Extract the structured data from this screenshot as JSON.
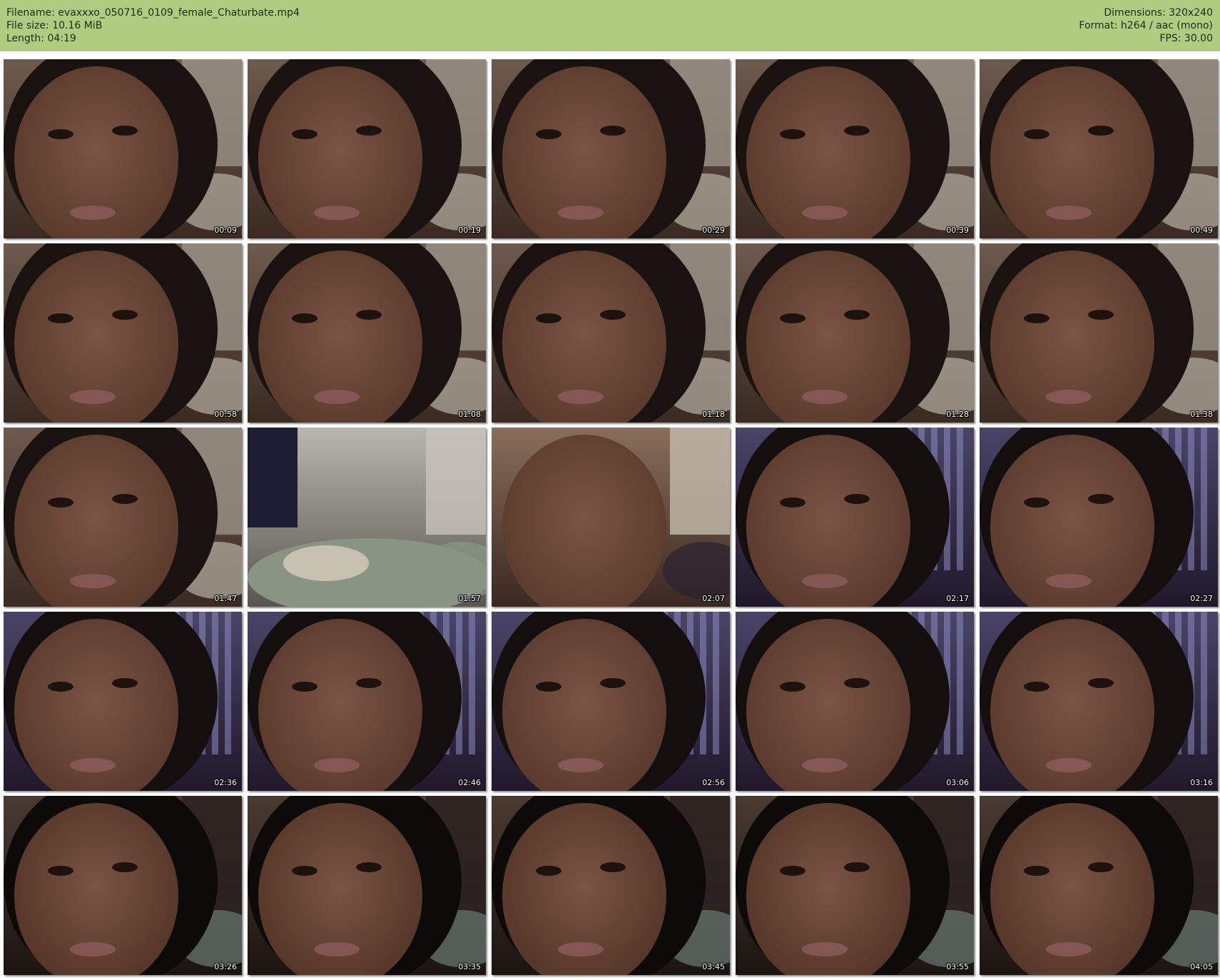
{
  "header": {
    "filename": "Filename: evaxxxo_050716_0109_female_Chaturbate.mp4",
    "file_size": "File size: 10.16 MiB",
    "length": "Length: 04:19",
    "dimensions": "Dimensions: 320x240",
    "format": "Format: h264 / aac (mono)",
    "fps": "FPS: 30.00"
  },
  "colors": {
    "header_bg": "#b0cc80",
    "page_bg": "#ffffff"
  },
  "thumbnails": [
    {
      "time": "00:09",
      "scene": "face"
    },
    {
      "time": "00:19",
      "scene": "face"
    },
    {
      "time": "00:29",
      "scene": "face"
    },
    {
      "time": "00:39",
      "scene": "face"
    },
    {
      "time": "00:49",
      "scene": "face"
    },
    {
      "time": "00:58",
      "scene": "face"
    },
    {
      "time": "01:08",
      "scene": "face"
    },
    {
      "time": "01:18",
      "scene": "face"
    },
    {
      "time": "01:28",
      "scene": "face"
    },
    {
      "time": "01:38",
      "scene": "face"
    },
    {
      "time": "01:47",
      "scene": "face"
    },
    {
      "time": "01:57",
      "scene": "bed"
    },
    {
      "time": "02:07",
      "scene": "body"
    },
    {
      "time": "02:17",
      "scene": "curtain"
    },
    {
      "time": "02:27",
      "scene": "curtain"
    },
    {
      "time": "02:36",
      "scene": "curtain"
    },
    {
      "time": "02:46",
      "scene": "curtain"
    },
    {
      "time": "02:56",
      "scene": "curtain"
    },
    {
      "time": "03:06",
      "scene": "curtain"
    },
    {
      "time": "03:16",
      "scene": "curtain"
    },
    {
      "time": "03:26",
      "scene": "dark"
    },
    {
      "time": "03:35",
      "scene": "dark"
    },
    {
      "time": "03:45",
      "scene": "dark"
    },
    {
      "time": "03:55",
      "scene": "dark"
    },
    {
      "time": "04:05",
      "scene": "dark"
    }
  ]
}
